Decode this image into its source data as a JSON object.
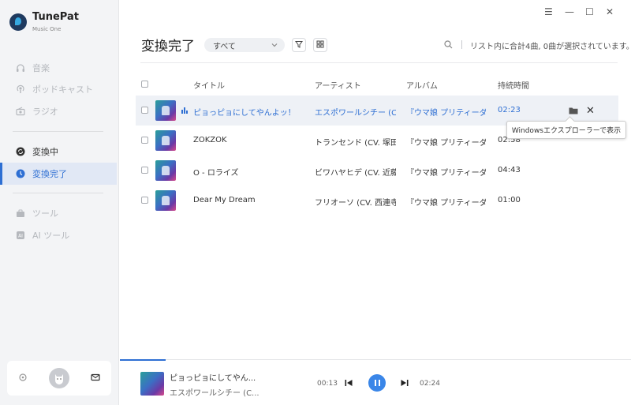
{
  "app": {
    "name": "TunePat",
    "subtitle": "Music One"
  },
  "window_controls": {
    "menu": "☰",
    "minimize": "—",
    "maximize": "☐",
    "close": "✕"
  },
  "sidebar": {
    "items": [
      {
        "label": "音楽",
        "icon": "headphones-icon"
      },
      {
        "label": "ポッドキャスト",
        "icon": "podcast-icon"
      },
      {
        "label": "ラジオ",
        "icon": "radio-icon"
      },
      {
        "label": "変換中",
        "icon": "converting-icon"
      },
      {
        "label": "変換完了",
        "icon": "clock-icon",
        "active": true
      },
      {
        "label": "ツール",
        "icon": "toolbox-icon"
      },
      {
        "label": "AI ツール",
        "icon": "ai-icon"
      }
    ]
  },
  "header": {
    "title": "変換完了",
    "filter_value": "すべて",
    "status": "リスト内に合計4曲, 0曲が選択されています。"
  },
  "table": {
    "columns": {
      "title": "タイトル",
      "artist": "アーティスト",
      "album": "アルバム",
      "duration": "持続時間"
    },
    "rows": [
      {
        "title": "ピョっピョにしてやんよッ！",
        "artist": "エスポワールシチー (C...",
        "album": "『ウマ娘 プリティーダ...",
        "duration": "02:23"
      },
      {
        "title": "ZOKZOK",
        "artist": "トランセンド (CV. 塚田...",
        "album": "『ウマ娘 プリティーダ...",
        "duration": "02:58"
      },
      {
        "title": "O - ロライズ",
        "artist": "ビワハヤヒデ (CV. 近藤...",
        "album": "『ウマ娘 プリティーダ...",
        "duration": "04:43"
      },
      {
        "title": "Dear My Dream",
        "artist": "フリオーソ (CV. 西連寺...",
        "album": "『ウマ娘 プリティーダ...",
        "duration": "01:00"
      }
    ]
  },
  "tooltip": "Windowsエクスプローラーで表示",
  "player": {
    "title": "ピョっピョにしてやん...",
    "artist": "エスポワールシチー (C...",
    "elapsed": "00:13",
    "total": "02:24",
    "progress": 0.09
  },
  "colors": {
    "accent": "#2e6fd3",
    "play": "#3a86e8"
  }
}
